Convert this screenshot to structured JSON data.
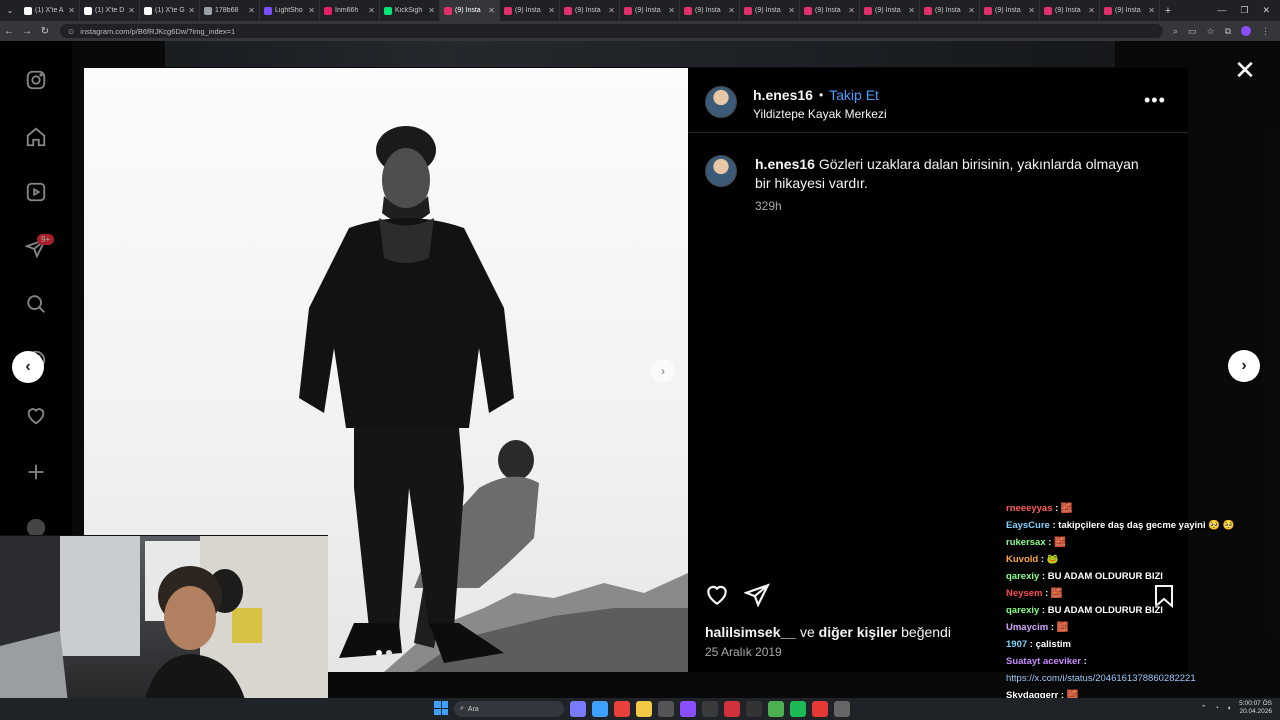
{
  "browser": {
    "tabs": [
      {
        "label": "(1) X'te A",
        "color": "#ffffff"
      },
      {
        "label": "(1) X'te D",
        "color": "#ffffff"
      },
      {
        "label": "(1) X'te G",
        "color": "#ffffff"
      },
      {
        "label": "178b68",
        "color": "#9aa0a6"
      },
      {
        "label": "LightSho",
        "color": "#7c4dff"
      },
      {
        "label": "Inm66h",
        "color": "#e91e63"
      },
      {
        "label": "KickSigh",
        "color": "#00e676"
      },
      {
        "label": "(9) Insta",
        "color": "#e1306c",
        "active": true
      },
      {
        "label": "(9) Insta",
        "color": "#e1306c"
      },
      {
        "label": "(9) Insta",
        "color": "#e1306c"
      },
      {
        "label": "(9) Insta",
        "color": "#e1306c"
      },
      {
        "label": "(9) Insta",
        "color": "#e1306c"
      },
      {
        "label": "(9) Insta",
        "color": "#e1306c"
      },
      {
        "label": "(9) Insta",
        "color": "#e1306c"
      },
      {
        "label": "(9) Insta",
        "color": "#e1306c"
      },
      {
        "label": "(9) Insta",
        "color": "#e1306c"
      },
      {
        "label": "(9) Insta",
        "color": "#e1306c"
      },
      {
        "label": "(9) Insta",
        "color": "#e1306c"
      },
      {
        "label": "(9) Insta",
        "color": "#e1306c"
      }
    ],
    "url": "instagram.com/p/B6fRJKcg6Dw/?img_index=1"
  },
  "sidebar": {
    "items": [
      {
        "name": "instagram-logo-icon",
        "icon": "logo"
      },
      {
        "name": "home-icon",
        "icon": "home"
      },
      {
        "name": "reels-icon",
        "icon": "reels"
      },
      {
        "name": "messages-icon",
        "icon": "send"
      },
      {
        "name": "search-icon",
        "icon": "search"
      },
      {
        "name": "explore-icon",
        "icon": "compass"
      },
      {
        "name": "notifications-icon",
        "icon": "heart"
      },
      {
        "name": "create-icon",
        "icon": "plus"
      },
      {
        "name": "profile-icon",
        "icon": "profile"
      }
    ],
    "badge": "9+"
  },
  "post": {
    "username": "h.enes16",
    "separator": "•",
    "follow_label": "Takip Et",
    "location": "Yildiztepe Kayak Merkezi",
    "more_label": "•••",
    "caption_user": "h.enes16",
    "caption_text": " Gözleri uzaklara dalan birisinin, yakınlarda olmayan bir hikayesi vardır.",
    "caption_time": "329h",
    "liked_by_user": "halilsimsek__",
    "liked_by_mid": " ve ",
    "liked_by_others": "diğer kişiler",
    "liked_by_suffix": " beğendi",
    "date": "25 Aralık 2019"
  },
  "controls": {
    "close": "✕",
    "prev": "‹",
    "next": "›"
  },
  "chat": [
    {
      "user": "rneeeyyas",
      "color": "#ff5b5b",
      "msg": " : 🧱"
    },
    {
      "user": "EaysCure",
      "color": "#7fd4ff",
      "msg": " : takipçilere daş daş gecme yayini 🥺 🥺"
    },
    {
      "user": "rukersax",
      "color": "#8aff8a",
      "msg": " : 🧱"
    },
    {
      "user": "Kuvold",
      "color": "#ffa640",
      "msg": " : 🐸"
    },
    {
      "user": "qarexiy",
      "color": "#8aff8a",
      "msg": " : BU ADAM OLDURUR BIZI"
    },
    {
      "user": "Neysem",
      "color": "#ff4a4a",
      "msg": " : 🧱"
    },
    {
      "user": "qarexiy",
      "color": "#8aff8a",
      "msg": " : BU ADAM OLDURUR BIZI"
    },
    {
      "user": "Umaycim",
      "color": "#d3a6ff",
      "msg": " : 🧱"
    },
    {
      "user": "1907",
      "color": "#7fd4ff",
      "msg": " : çalistim"
    },
    {
      "user": "Suatayt aceviker",
      "color": "#c78bff",
      "msg": " :"
    },
    {
      "user": "",
      "color": "#9ecbff",
      "msg": "",
      "link": "https://x.com/i/status/2046161378860282221"
    },
    {
      "user": "Skydaggerr",
      "color": "#ffffff",
      "msg": " : 🧱"
    }
  ],
  "taskbar": {
    "search_label": "Ara",
    "time": "5:00:07 ÖS",
    "date": "20.04.2026"
  }
}
